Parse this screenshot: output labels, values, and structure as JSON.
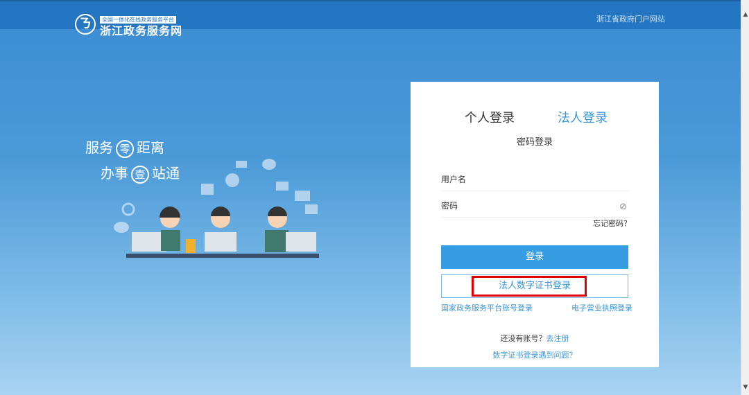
{
  "header": {
    "logo_mark": "ㄋ",
    "logo_sub": "全国一体化在线政务服务平台",
    "logo_main": "浙江政务服务网",
    "portal_link": "浙江省政府门户网站"
  },
  "slogan": {
    "line1_a": "服务",
    "line1_circle": "零",
    "line1_b": "距离",
    "line2_a": "办事",
    "line2_circle": "壹",
    "line2_b": "站通"
  },
  "login": {
    "tabs": [
      {
        "label": "个人登录",
        "active": false
      },
      {
        "label": "法人登录",
        "active": true
      }
    ],
    "method_title": "密码登录",
    "username_placeholder": "用户名",
    "password_placeholder": "密码",
    "forgot": "忘记密码？",
    "login_button": "登录",
    "cert_button": "法人数字证书登录",
    "national_link": "国家政务服务平台账号登录",
    "license_link": "电子营业执照登录",
    "no_account": "还没有账号？",
    "register": "去注册",
    "cert_help": "数字证书登录遇到问题？"
  },
  "colors": {
    "accent": "#379de3",
    "header": "#2476c2",
    "highlight": "#e00000"
  }
}
